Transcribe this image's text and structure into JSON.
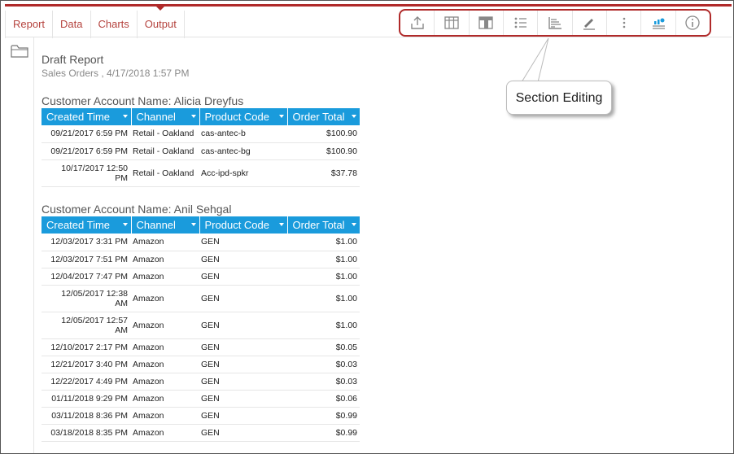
{
  "tabs": [
    {
      "label": "Report"
    },
    {
      "label": "Data"
    },
    {
      "label": "Charts"
    },
    {
      "label": "Output",
      "active": true
    }
  ],
  "toolbar": {
    "icons": [
      "export-icon",
      "table-icon",
      "layout-icon",
      "list-icon",
      "section-editing-icon",
      "format-icon",
      "more-options-icon",
      "chart-icon",
      "info-icon"
    ]
  },
  "report": {
    "title": "Draft Report",
    "subtitle": "Sales Orders , 4/17/2018 1:57 PM"
  },
  "columns": [
    "Created Time",
    "Channel",
    "Product Code",
    "Order Total"
  ],
  "groups": [
    {
      "name": "Customer Account Name: Alicia Dreyfus",
      "rows": [
        {
          "time": "09/21/2017 6:59 PM",
          "channel": "Retail - Oakland",
          "code": "cas-antec-b",
          "total": "$100.90"
        },
        {
          "time": "09/21/2017 6:59 PM",
          "channel": "Retail - Oakland",
          "code": "cas-antec-bg",
          "total": "$100.90"
        },
        {
          "time_a": "10/17/2017 12:50",
          "time_b": "PM",
          "channel": "Retail - Oakland",
          "code": "Acc-ipd-spkr",
          "total": "$37.78"
        }
      ]
    },
    {
      "name": "Customer Account Name: Anil Sehgal",
      "rows": [
        {
          "time": "12/03/2017 3:31 PM",
          "channel": "Amazon",
          "code": "GEN",
          "total": "$1.00"
        },
        {
          "time": "12/03/2017 7:51 PM",
          "channel": "Amazon",
          "code": "GEN",
          "total": "$1.00"
        },
        {
          "time": "12/04/2017 7:47 PM",
          "channel": "Amazon",
          "code": "GEN",
          "total": "$1.00"
        },
        {
          "time_a": "12/05/2017 12:38",
          "time_b": "AM",
          "channel": "Amazon",
          "code": "GEN",
          "total": "$1.00"
        },
        {
          "time_a": "12/05/2017 12:57",
          "time_b": "AM",
          "channel": "Amazon",
          "code": "GEN",
          "total": "$1.00"
        },
        {
          "time": "12/10/2017 2:17 PM",
          "channel": "Amazon",
          "code": "GEN",
          "total": "$0.05"
        },
        {
          "time": "12/21/2017 3:40 PM",
          "channel": "Amazon",
          "code": "GEN",
          "total": "$0.03"
        },
        {
          "time": "12/22/2017 4:49 PM",
          "channel": "Amazon",
          "code": "GEN",
          "total": "$0.03"
        },
        {
          "time": "01/11/2018 9:29 PM",
          "channel": "Amazon",
          "code": "GEN",
          "total": "$0.06"
        },
        {
          "time": "03/11/2018 8:36 PM",
          "channel": "Amazon",
          "code": "GEN",
          "total": "$0.99"
        },
        {
          "time": "03/18/2018 8:35 PM",
          "channel": "Amazon",
          "code": "GEN",
          "total": "$0.99"
        }
      ]
    }
  ],
  "callout": {
    "label": "Section Editing"
  },
  "colors": {
    "accent": "#b02a2a",
    "header_blue": "#1a9bdc",
    "tab_text": "#b5433e"
  }
}
